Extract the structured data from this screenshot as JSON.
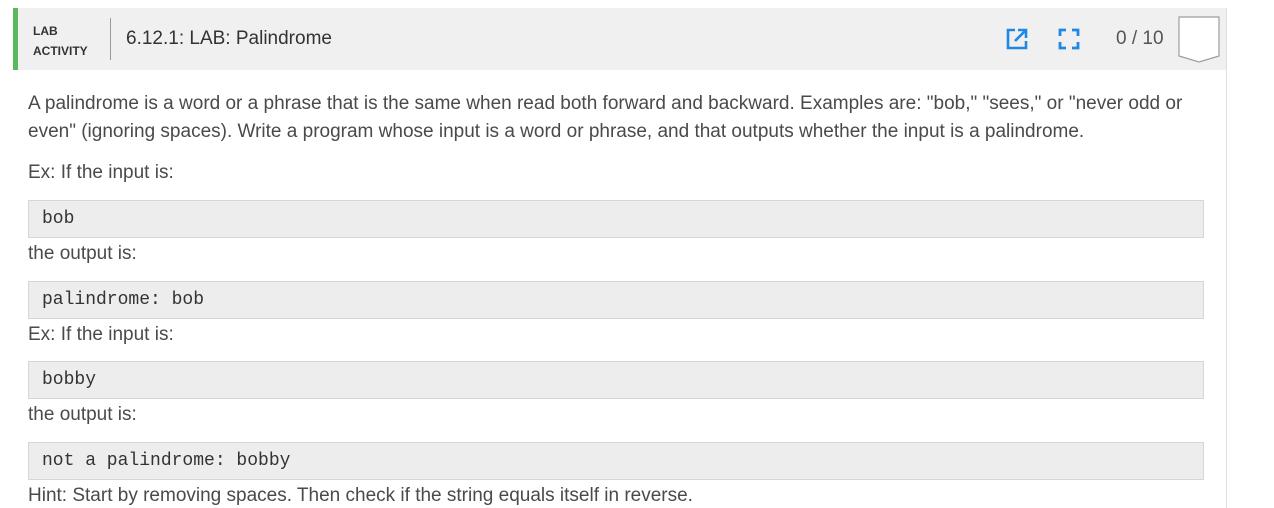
{
  "header": {
    "label_line1": "LAB",
    "label_line2": "ACTIVITY",
    "title": "6.12.1: LAB: Palindrome",
    "score": "0 / 10",
    "accent_color": "#5cb85c",
    "icon_color": "#1e88e5",
    "icons": [
      "popout-icon",
      "fullscreen-icon",
      "completion-badge-icon"
    ]
  },
  "content": {
    "intro_line1": "A palindrome is a word or a phrase that is the same when read both forward and backward. Examples are: \"bob,\" \"sees,\" or \"never odd or",
    "intro_line2": "even\" (ignoring spaces). Write a program whose input is a word or phrase, and that outputs whether the input is a palindrome.",
    "example1_label": "Ex: If the input is:",
    "example1_input": "bob",
    "example1_output_label": "the output is:",
    "example1_output": "palindrome: bob",
    "example2_label": "Ex: If the input is:",
    "example2_input": "bobby",
    "example2_output_label": "the output is:",
    "example2_output": "not a palindrome: bobby",
    "hint": "Hint: Start by removing spaces. Then check if the string equals itself in reverse."
  }
}
